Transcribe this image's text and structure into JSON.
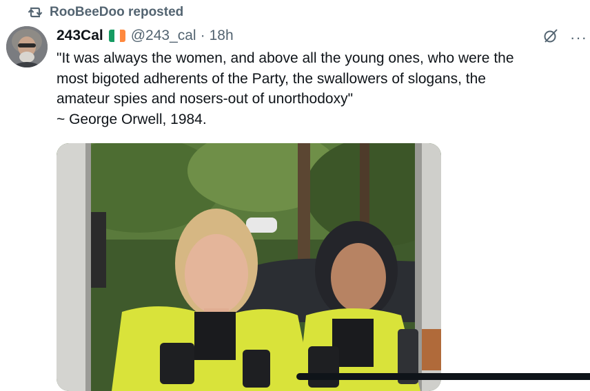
{
  "repost": {
    "icon": "repost-icon",
    "label": "RooBeeDoo reposted"
  },
  "tweet": {
    "author": {
      "display_name": "243Cal",
      "flag": "ireland-flag-icon",
      "flag_colors": [
        "#169b62",
        "#ffffff",
        "#ff883e"
      ],
      "handle": "@243_cal",
      "separator": "·",
      "time": "18h"
    },
    "icons": [
      "grok-icon",
      "more-icon"
    ],
    "text_lines": [
      "\"It was always the women, and above all the young ones, who were the",
      "most bigoted adherents of the Party, the swallowers of slogans, the",
      "amateur spies and nosers-out of unorthodoxy\"",
      "~ George Orwell, 1984."
    ],
    "media": {
      "type": "video",
      "description_icon": "video-thumbnail"
    }
  },
  "colors": {
    "text_primary": "#0f1419",
    "text_secondary": "#536471",
    "hi_vis_yellow": "#d9e33a"
  }
}
